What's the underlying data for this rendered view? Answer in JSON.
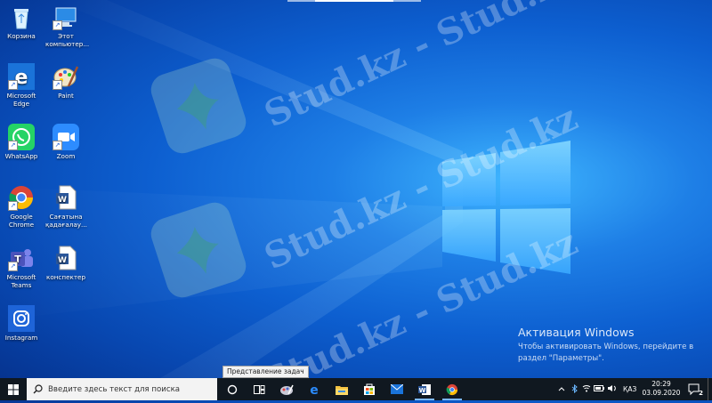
{
  "desktop": {
    "icons": [
      {
        "label": "Корзина",
        "icon": "recycle-bin-icon"
      },
      {
        "label": "Этот компьютер...",
        "icon": "this-pc-icon"
      },
      {
        "label": "Microsoft Edge",
        "icon": "edge-icon"
      },
      {
        "label": "Paint",
        "icon": "paint-icon"
      },
      {
        "label": "WhatsApp",
        "icon": "whatsapp-icon"
      },
      {
        "label": "Zoom",
        "icon": "zoom-icon"
      },
      {
        "label": "Google Chrome",
        "icon": "chrome-icon"
      },
      {
        "label": "Сағатына қадағалау...",
        "icon": "word-doc-icon"
      },
      {
        "label": "Microsoft Teams",
        "icon": "teams-icon"
      },
      {
        "label": "конспектер",
        "icon": "word-doc-icon"
      },
      {
        "label": "Instagram",
        "icon": "instagram-icon"
      }
    ]
  },
  "watermark": {
    "text": "Stud.kz - Stud.kz"
  },
  "activation": {
    "title": "Активация Windows",
    "line1": "Чтобы активировать Windows, перейдите в",
    "line2": "раздел \"Параметры\"."
  },
  "tooltip": {
    "text": "Представление задач"
  },
  "taskbar": {
    "search_placeholder": "Введите здесь текст для поиска",
    "pinned": [
      "cortana-icon",
      "task-view-icon",
      "app-icon",
      "edge-icon",
      "file-explorer-icon",
      "store-icon",
      "mail-icon",
      "word-icon",
      "chrome-icon"
    ],
    "tray": {
      "language": "ҚАЗ"
    },
    "clock": {
      "time": "20:29",
      "date": "03.09.2020"
    },
    "notifications": "2"
  },
  "colors": {
    "taskbar": "#101820",
    "desktop_accent": "#1e7fe6"
  }
}
